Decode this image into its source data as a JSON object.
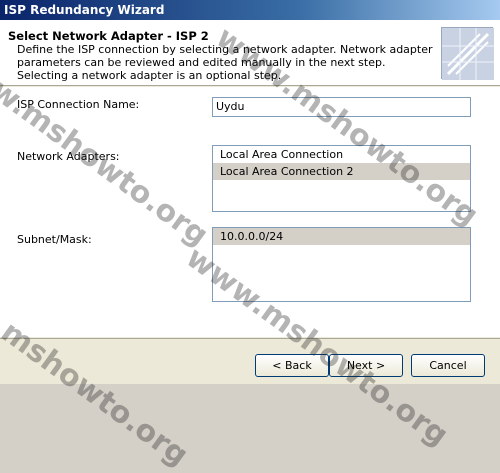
{
  "window": {
    "title": "ISP Redundancy Wizard"
  },
  "header": {
    "title": "Select Network Adapter - ISP 2",
    "description": "Define the ISP connection by selecting a network adapter. Network adapter parameters can be reviewed and edited manually in the next step. Selecting a network adapter is an optional step."
  },
  "form": {
    "isp_name_label": "ISP Connection Name:",
    "isp_name_value": "Uydu",
    "adapters_label": "Network Adapters:",
    "adapters": [
      {
        "label": "Local Area Connection",
        "selected": false
      },
      {
        "label": "Local Area Connection 2",
        "selected": true
      }
    ],
    "subnet_label": "Subnet/Mask:",
    "subnets": [
      {
        "label": "10.0.0.0/24",
        "selected": true
      }
    ]
  },
  "buttons": {
    "back": "< Back",
    "next": "Next >",
    "cancel": "Cancel"
  },
  "watermark": {
    "text": "www.mshowto.org"
  },
  "colors": {
    "title_bar": "#0a246a",
    "selection": "#d4d0c8"
  }
}
